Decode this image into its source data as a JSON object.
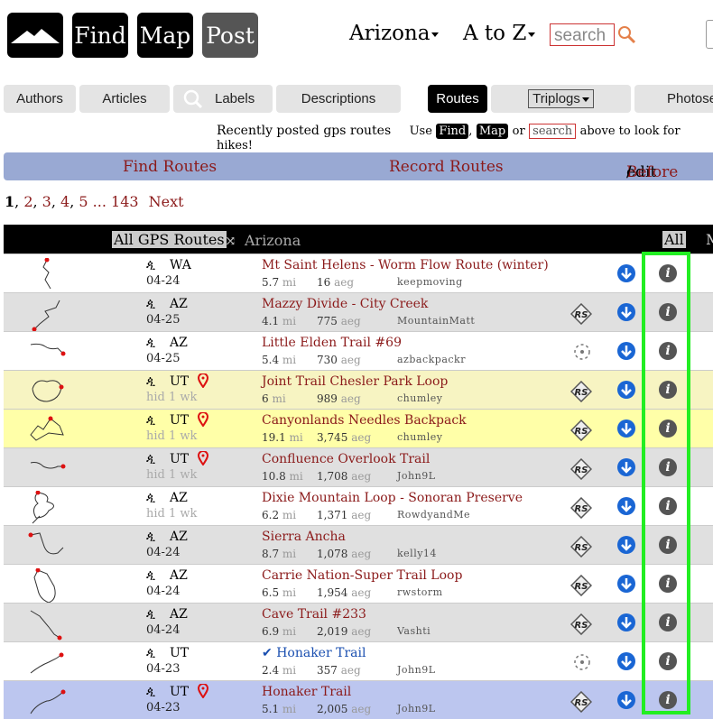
{
  "header": {
    "find": "Find",
    "map": "Map",
    "post": "Post",
    "region": "Arizona",
    "atoz": "A to Z",
    "search_placeholder": "search"
  },
  "tabs": {
    "authors": "Authors",
    "articles": "Articles",
    "labels": "Labels",
    "descriptions": "Descriptions",
    "routes": "Routes",
    "triplogs": "Triplogs",
    "photosets": "Photose"
  },
  "info": {
    "lead": "Recently posted gps routes",
    "use": "Use",
    "find": "Find",
    "map": "Map",
    "or": "or",
    "search": "search",
    "tail": "above to look for hikes!"
  },
  "bar": {
    "find_routes": "Find Routes",
    "record_routes": "Record Routes",
    "edit": "edit",
    "before": "Before",
    "slash": "/"
  },
  "pager": {
    "p1": "1",
    "p2": "2",
    "p3": "3",
    "p4": "4",
    "p5": "5",
    "ellipsis": "...",
    "last": "143",
    "next": "Next"
  },
  "table_header": {
    "all_gps": "All GPS Routes",
    "region": "Arizona",
    "all": "All",
    "more": "M"
  },
  "rows": [
    {
      "state": "WA",
      "date": "04-24",
      "title": "Mt Saint Helens - Worm Flow Route (winter)",
      "mi": "5.7",
      "aeg": "16",
      "user": "keepmoving",
      "pin": false,
      "rs": false,
      "dash": false,
      "check": false,
      "bg": "#ffffff"
    },
    {
      "state": "AZ",
      "date": "04-25",
      "title": "Mazzy Divide - City Creek",
      "mi": "4.1",
      "aeg": "775",
      "user": "MountainMatt",
      "pin": false,
      "rs": true,
      "dash": false,
      "check": false,
      "bg": "#e0e0e0"
    },
    {
      "state": "AZ",
      "date": "04-25",
      "title": "Little Elden Trail #69",
      "mi": "5.4",
      "aeg": "730",
      "user": "azbackpackr",
      "pin": false,
      "rs": false,
      "dash": true,
      "check": false,
      "bg": "#ffffff"
    },
    {
      "state": "UT",
      "date": "hid 1 wk",
      "title": "Joint Trail Chesler Park Loop",
      "mi": "6",
      "aeg": "989",
      "user": "chumley",
      "pin": true,
      "rs": true,
      "dash": false,
      "check": false,
      "bg": "#f7f4c2"
    },
    {
      "state": "UT",
      "date": "hid 1 wk",
      "title": "Canyonlands Needles Backpack",
      "mi": "19.1",
      "aeg": "3,745",
      "user": "chumley",
      "pin": true,
      "rs": true,
      "dash": false,
      "check": false,
      "bg": "#ffffa8"
    },
    {
      "state": "UT",
      "date": "hid 1 wk",
      "title": "Confluence Overlook Trail",
      "mi": "10.8",
      "aeg": "1,708",
      "user": "John9L",
      "pin": true,
      "rs": true,
      "dash": false,
      "check": false,
      "bg": "#e0e0e0"
    },
    {
      "state": "AZ",
      "date": "hid 1 wk",
      "title": "Dixie Mountain Loop - Sonoran Preserve",
      "mi": "6.2",
      "aeg": "1,371",
      "user": "RowdyandMe",
      "pin": false,
      "rs": true,
      "dash": false,
      "check": false,
      "bg": "#ffffff"
    },
    {
      "state": "AZ",
      "date": "04-24",
      "title": "Sierra Ancha",
      "mi": "8.7",
      "aeg": "1,078",
      "user": "kelly14",
      "pin": false,
      "rs": true,
      "dash": false,
      "check": false,
      "bg": "#e0e0e0"
    },
    {
      "state": "AZ",
      "date": "04-24",
      "title": "Carrie Nation-Super Trail Loop",
      "mi": "6.5",
      "aeg": "1,954",
      "user": "rwstorm",
      "pin": false,
      "rs": true,
      "dash": false,
      "check": false,
      "bg": "#ffffff"
    },
    {
      "state": "AZ",
      "date": "04-24",
      "title": "Cave Trail #233",
      "mi": "6.9",
      "aeg": "2,019",
      "user": "Vashti",
      "pin": false,
      "rs": true,
      "dash": false,
      "check": false,
      "bg": "#e0e0e0"
    },
    {
      "state": "UT",
      "date": "04-23",
      "title": "Honaker Trail",
      "mi": "2.4",
      "aeg": "357",
      "user": "John9L",
      "pin": false,
      "rs": false,
      "dash": true,
      "check": true,
      "bg": "#ffffff"
    },
    {
      "state": "UT",
      "date": "04-23",
      "title": "Honaker Trail",
      "mi": "5.1",
      "aeg": "2,005",
      "user": "John9L",
      "pin": true,
      "rs": true,
      "dash": false,
      "check": false,
      "bg": "#bcc6ef"
    }
  ],
  "units": {
    "mi": "mi",
    "aeg": "aeg"
  },
  "info_glyph": "i",
  "colors": {
    "accent": "#8b1a1a",
    "bar": "#99a9d3",
    "download": "#1a66d4",
    "highlight": "#22ee22"
  }
}
